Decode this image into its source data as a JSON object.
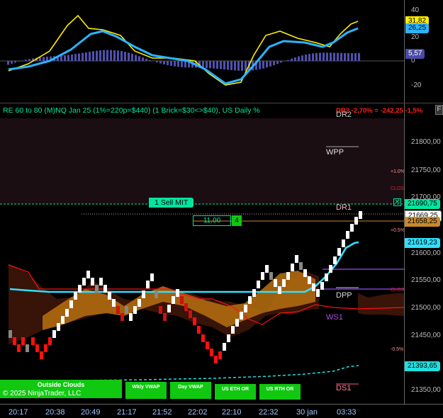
{
  "colors": {
    "bg": "#000000",
    "accent": "#00e5a0",
    "up": "#ffffff",
    "down": "#ff1010",
    "macd": "#2ab4ff",
    "signal": "#ffee00"
  },
  "oscillator": {
    "axis_ticks": [
      "40",
      "20",
      "0",
      "-20"
    ],
    "tag_yellow": "31,82",
    "tag_cyan": "26,25",
    "tag_hist": "5,57"
  },
  "header": {
    "title": "RE 60 to 80 (M)NQ Jan 25 (1%=220p=$440) (1 Brick=$30<>$40), US Daily %",
    "corner_btn": "F",
    "red_value": "DR2 -2,70% = -242,25 -1,5%"
  },
  "price_axis": [
    "21800,00",
    "21750,00",
    "21700,00",
    "21600,00",
    "21550,00",
    "21500,00",
    "21450,00",
    "21350,00"
  ],
  "price_tags": {
    "current": "21690,75",
    "last": "21669,25",
    "level2": "21658,25",
    "level3": "21619,23",
    "level4": "21393,65"
  },
  "order": {
    "sell_label": "1 Sell MIT",
    "qty": "11,00",
    "count": "4"
  },
  "levels": {
    "dr2": "DR2",
    "wpp": "WPP",
    "dr1": "DR1",
    "dpp": "DPP",
    "ws1": "WS1",
    "ds1": "DS1"
  },
  "pct_labels": {
    "p1": "+1.0%",
    "p05": "+0.5%",
    "m05": "-0.5%",
    "close1": "CLOS",
    "close2": "CLOS"
  },
  "chart_data": {
    "type": "renko",
    "time_labels": [
      "20:17",
      "20:38",
      "20:49",
      "21:17",
      "21:52",
      "22:02",
      "22:10",
      "22:32",
      "30 jan",
      "03:33"
    ]
  },
  "buttons": [
    "Outside Clouds",
    "Wkly VWAP",
    "Day VWAP",
    "US ETH OR",
    "US RTH OR"
  ],
  "copyright": "© 2025 NinjaTrader, LLC"
}
